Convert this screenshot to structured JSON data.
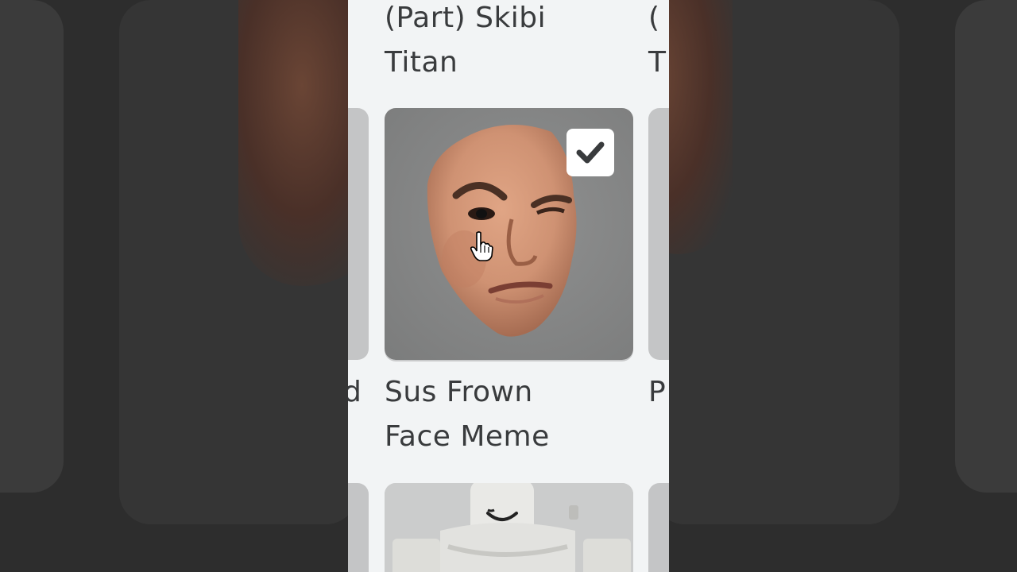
{
  "catalog": {
    "items": [
      {
        "name": "(Part) Skibi\nTitan"
      },
      {
        "name": "Sus Frown\nFace Meme"
      }
    ],
    "partial_left": {
      "name_fragment": "d"
    },
    "partial_right": {
      "name_fragment_top": "(\nT",
      "name_fragment_bottom": "P"
    },
    "selected_item": {
      "name": "Sus Frown Face Meme",
      "owned_checkmark": "check-icon"
    }
  },
  "colors": {
    "panel_background": "#f2f4f5",
    "text": "#393b3d",
    "thumbnail_background": "#858686",
    "check_color": "#393b3d"
  }
}
